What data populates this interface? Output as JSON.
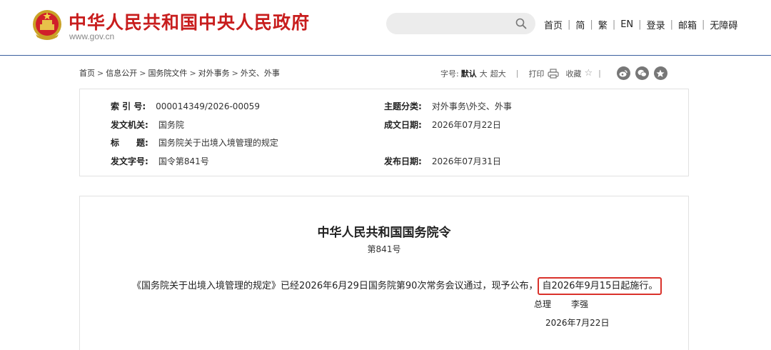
{
  "header": {
    "site_title": "中华人民共和国中央人民政府",
    "site_url": "www.gov.cn",
    "brand_color": "#c81d1d",
    "nav": [
      "首页",
      "简",
      "繁",
      "EN",
      "登录",
      "邮箱",
      "无障碍"
    ]
  },
  "breadcrumb": [
    "首页",
    "信息公开",
    "国务院文件",
    "对外事务",
    "外交、外事"
  ],
  "toolbar": {
    "font_size_label": "字号:",
    "font_default": "默认",
    "font_large": "大",
    "font_xlarge": "超大",
    "print": "打印",
    "favorite": "收藏",
    "share_icons": [
      "weibo-icon",
      "wechat-icon",
      "qzone-icon"
    ]
  },
  "meta": {
    "index_label": "索 引 号:",
    "index_value": "000014349/2026-00059",
    "topic_label": "主题分类:",
    "topic_value": "对外事务\\外交、外事",
    "issuer_label": "发文机关:",
    "issuer_value": "国务院",
    "written_label": "成文日期:",
    "written_value": "2026年07月22日",
    "title_label": "标　　题:",
    "title_value": "国务院关于出境入境管理的规定",
    "docno_label": "发文字号:",
    "docno_value": "国令第841号",
    "published_label": "发布日期:",
    "published_value": "2026年07月31日"
  },
  "document": {
    "title": "中华人民共和国国务院令",
    "number": "第841号",
    "body_main": "《国务院关于出境入境管理的规定》已经2026年6月29日国务院第90次常务会议通过，现予公布，",
    "body_highlight": "自2026年9月15日起施行。",
    "highlight_color": "#d9322b",
    "signer_role": "总理",
    "signer_name": "李强",
    "sign_date": "2026年7月22日"
  }
}
